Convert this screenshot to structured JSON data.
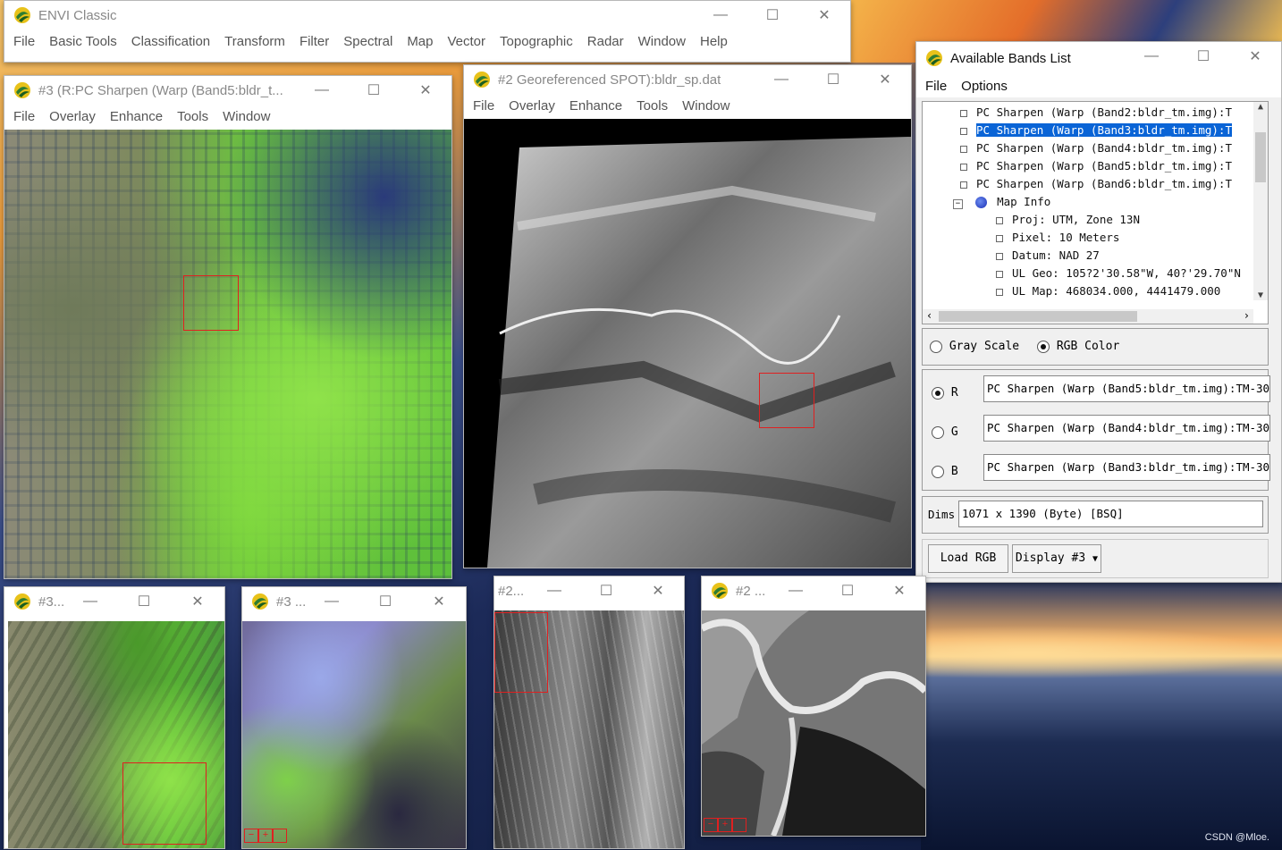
{
  "envi_main": {
    "title": "ENVI Classic",
    "menu": [
      "File",
      "Basic Tools",
      "Classification",
      "Transform",
      "Filter",
      "Spectral",
      "Map",
      "Vector",
      "Topographic",
      "Radar",
      "Window",
      "Help"
    ]
  },
  "display3": {
    "title": "#3 (R:PC Sharpen (Warp (Band5:bldr_t...",
    "menu": [
      "File",
      "Overlay",
      "Enhance",
      "Tools",
      "Window"
    ]
  },
  "display2": {
    "title": "#2 Georeferenced SPOT):bldr_sp.dat",
    "menu": [
      "File",
      "Overlay",
      "Enhance",
      "Tools",
      "Window"
    ]
  },
  "bands": {
    "title": "Available Bands List",
    "menu": [
      "File",
      "Options"
    ],
    "tree": [
      {
        "text": "PC Sharpen (Warp (Band2:bldr_tm.img):T",
        "selected": false
      },
      {
        "text": "PC Sharpen (Warp (Band3:bldr_tm.img):T",
        "selected": true
      },
      {
        "text": "PC Sharpen (Warp (Band4:bldr_tm.img):T",
        "selected": false
      },
      {
        "text": "PC Sharpen (Warp (Band5:bldr_tm.img):T",
        "selected": false
      },
      {
        "text": "PC Sharpen (Warp (Band6:bldr_tm.img):T",
        "selected": false
      }
    ],
    "map_info_label": "Map Info",
    "map_info": [
      "Proj: UTM, Zone 13N",
      "Pixel: 10 Meters",
      "Datum: NAD 27",
      "UL Geo: 105?2'30.58\"W, 40?'29.70\"N",
      "UL Map: 468034.000, 4441479.000"
    ],
    "gray_scale_label": "Gray Scale",
    "rgb_color_label": "RGB Color",
    "r_label": "R",
    "g_label": "G",
    "b_label": "B",
    "r_value": "PC Sharpen (Warp (Band5:bldr_tm.img):TM-30",
    "g_value": "PC Sharpen (Warp (Band4:bldr_tm.img):TM-30",
    "b_value": "PC Sharpen (Warp (Band3:bldr_tm.img):TM-30",
    "dims_label": "Dims",
    "dims_value": "1071 x 1390 (Byte) [BSQ]",
    "load_rgb": "Load RGB",
    "display_btn": "Display #3"
  },
  "scroll3": {
    "title": "#3..."
  },
  "zoom3": {
    "title": "#3 ..."
  },
  "scroll2": {
    "title": "#2..."
  },
  "zoom2": {
    "title": "#2 ..."
  },
  "watermark": "CSDN @Mloe."
}
